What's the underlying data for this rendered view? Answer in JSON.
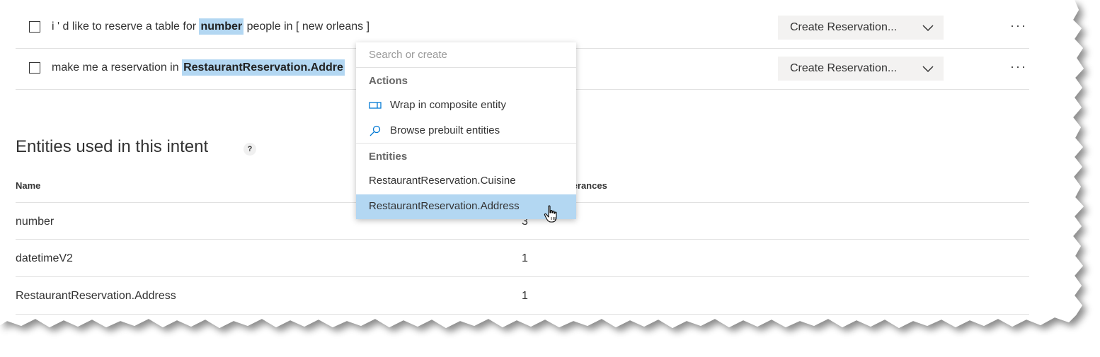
{
  "utterances": [
    {
      "prefix": "i ' d like to reserve a table for ",
      "token": "number",
      "suffix": " people in [ new orleans ]",
      "intent_label": "Create Reservation..."
    },
    {
      "prefix": "make me a reservation in ",
      "token": "RestaurantReservation.Addre",
      "suffix": "",
      "intent_label": "Create Reservation..."
    }
  ],
  "more_glyph": "···",
  "entities_section": {
    "title": "Entities used in this intent",
    "help": "?",
    "col_name": "Name",
    "col_count": "tterances",
    "rows": [
      {
        "name": "number",
        "count": "3"
      },
      {
        "name": "datetimeV2",
        "count": "1"
      },
      {
        "name": "RestaurantReservation.Address",
        "count": "1"
      }
    ]
  },
  "dropdown": {
    "search_placeholder": "Search or create",
    "actions_header": "Actions",
    "actions": [
      {
        "label": "Wrap in composite entity",
        "icon": "composite-icon"
      },
      {
        "label": "Browse prebuilt entities",
        "icon": "search-icon"
      }
    ],
    "entities_header": "Entities",
    "entities": [
      {
        "label": "RestaurantReservation.Cuisine",
        "selected": false
      },
      {
        "label": "RestaurantReservation.Address",
        "selected": true
      }
    ]
  },
  "colors": {
    "highlight": "#b3d7f2",
    "icon_blue": "#0078d4",
    "select_bg": "#f3f2f1"
  }
}
